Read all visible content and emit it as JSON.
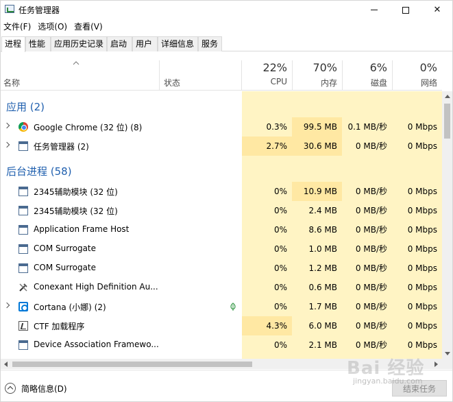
{
  "window": {
    "title": "任务管理器",
    "minimize": "—",
    "maximize": "☐",
    "close": "✕"
  },
  "menu": [
    "文件(F)",
    "选项(O)",
    "查看(V)"
  ],
  "tabs": [
    "进程",
    "性能",
    "应用历史记录",
    "启动",
    "用户",
    "详细信息",
    "服务"
  ],
  "columns": {
    "name": "名称",
    "status": "状态",
    "cpu": {
      "pct": "22%",
      "label": "CPU"
    },
    "memory": {
      "pct": "70%",
      "label": "内存"
    },
    "disk": {
      "pct": "6%",
      "label": "磁盘"
    },
    "network": {
      "pct": "0%",
      "label": "网络"
    }
  },
  "groups": {
    "apps": "应用 (2)",
    "background": "后台进程 (58)"
  },
  "apps": [
    {
      "name": "Google Chrome (32 位) (8)",
      "icon": "chrome-icon",
      "cpu": "0.3%",
      "mem": "99.5 MB",
      "disk": "0.1 MB/秒",
      "net": "0 Mbps",
      "expandable": true
    },
    {
      "name": "任务管理器 (2)",
      "icon": "task-manager-icon",
      "cpu": "2.7%",
      "mem": "30.6 MB",
      "disk": "0 MB/秒",
      "net": "0 Mbps",
      "expandable": true
    }
  ],
  "background": [
    {
      "name": "2345辅助模块 (32 位)",
      "icon": "window-icon",
      "cpu": "0%",
      "mem": "10.9 MB",
      "disk": "0 MB/秒",
      "net": "0 Mbps",
      "expandable": false
    },
    {
      "name": "2345辅助模块 (32 位)",
      "icon": "window-icon",
      "cpu": "0%",
      "mem": "2.4 MB",
      "disk": "0 MB/秒",
      "net": "0 Mbps",
      "expandable": false
    },
    {
      "name": "Application Frame Host",
      "icon": "window-icon",
      "cpu": "0%",
      "mem": "8.6 MB",
      "disk": "0 MB/秒",
      "net": "0 Mbps",
      "expandable": false
    },
    {
      "name": "COM Surrogate",
      "icon": "window-icon",
      "cpu": "0%",
      "mem": "1.0 MB",
      "disk": "0 MB/秒",
      "net": "0 Mbps",
      "expandable": false
    },
    {
      "name": "COM Surrogate",
      "icon": "window-icon",
      "cpu": "0%",
      "mem": "1.2 MB",
      "disk": "0 MB/秒",
      "net": "0 Mbps",
      "expandable": false
    },
    {
      "name": "Conexant High Definition Au...",
      "icon": "tools-icon",
      "cpu": "0%",
      "mem": "0.6 MB",
      "disk": "0 MB/秒",
      "net": "0 Mbps",
      "expandable": false
    },
    {
      "name": "Cortana (小娜) (2)",
      "icon": "cortana-icon",
      "cpu": "0%",
      "mem": "1.7 MB",
      "disk": "0 MB/秒",
      "net": "0 Mbps",
      "expandable": true,
      "suspended": true
    },
    {
      "name": "CTF 加载程序",
      "icon": "ctf-icon",
      "cpu": "4.3%",
      "mem": "6.0 MB",
      "disk": "0 MB/秒",
      "net": "0 Mbps",
      "expandable": false
    },
    {
      "name": "Device Association Framewo...",
      "icon": "window-icon",
      "cpu": "0%",
      "mem": "2.1 MB",
      "disk": "0 MB/秒",
      "net": "0 Mbps",
      "expandable": false
    }
  ],
  "footer": {
    "fewer_details": "简略信息(D)",
    "end_task": "结束任务"
  },
  "watermark": {
    "main": "Bai 经验",
    "sub": "jingyan.baidu.com"
  },
  "colors": {
    "heat_light": "#fff4c4",
    "heat_mid": "#ffe8a3",
    "group_text": "#1f5fae"
  }
}
